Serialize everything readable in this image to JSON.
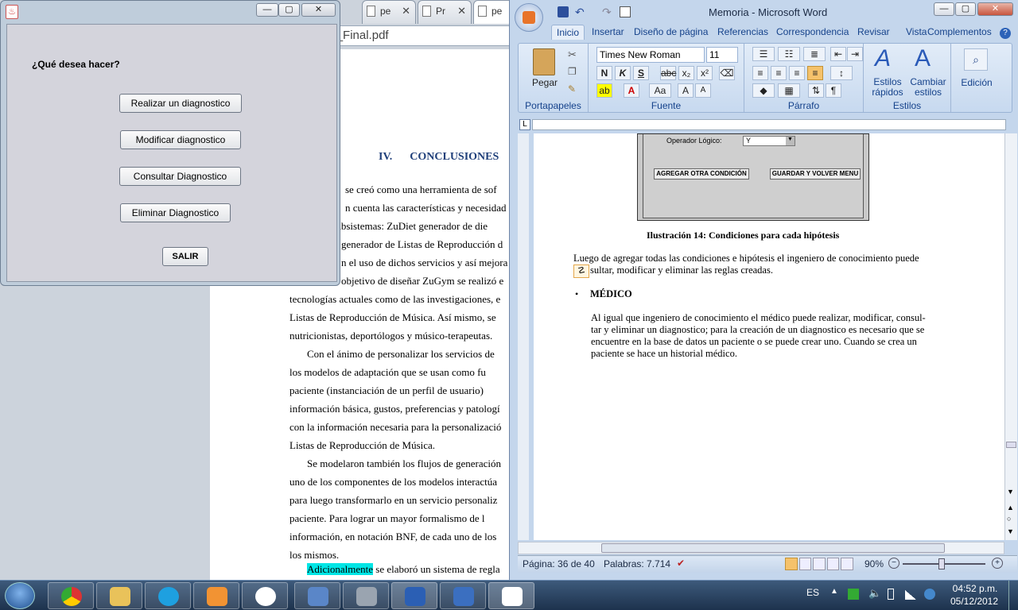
{
  "browser": {
    "tabs": [
      "pe",
      "pe",
      "Pr",
      "pe"
    ],
    "url": "ientos/MemoriaZuGym_Final.pdf",
    "pdf": {
      "heading_num": "IV.",
      "heading": "CONCLUSIONES",
      "lines": [
        "se creó como una herramienta de sof",
        "n cuenta las características y necesidad",
        "s subsistemas: ZuDiet generador de die",
        "generador de Listas de Reproducción d",
        "n el uso de dichos servicios y así mejora",
        "objetivo de diseñar ZuGym se realizó e",
        "tecnologías actuales como de las investigaciones, e",
        "Listas de Reproducción de Música. Así mismo, se",
        "nutricionistas, deportólogos y músico-terapeutas.",
        "Con el ánimo de personalizar los servicios de",
        "los modelos de adaptación que se usan como fu",
        "paciente (instanciación de un perfil de usuario)",
        "información básica, gustos, preferencias y patologí",
        "con la información necesaria para la personalizació",
        "Listas de Reproducción de Música.",
        "Se modelaron también los flujos de generación",
        "uno de los componentes de los modelos interactúa",
        "para luego transformarlo en un servicio personaliz",
        "paciente. Para lograr un mayor formalismo de l",
        "información, en notación BNF, de cada uno de los",
        "los mismos."
      ],
      "last_highlight": "Adicionalmente",
      "last_rest": " se elaboró un sistema de regla"
    }
  },
  "dialog": {
    "question": "¿Qué desea hacer?",
    "btn_create": "Realizar un diagnostico",
    "btn_modify": "Modificar diagnostico",
    "btn_consult": "Consultar Diagnostico",
    "btn_delete": "Eliminar Diagnostico",
    "btn_exit": "SALIR"
  },
  "word": {
    "title": "Memoria - Microsoft Word",
    "tabs": [
      "Inicio",
      "Insertar",
      "Diseño de página",
      "Referencias",
      "Correspondencia",
      "Revisar",
      "Vista",
      "Complementos"
    ],
    "font_name": "Times New Roman",
    "font_size": "11",
    "groups": {
      "clipboard": "Portapapeles",
      "font": "Fuente",
      "paragraph": "Párrafo",
      "styles": "Estilos"
    },
    "paste": "Pegar",
    "styles_quick": "Estilos rápidos",
    "styles_change": "Cambiar estilos",
    "editing": "Edición",
    "doc": {
      "operator_label": "Operador Lógico:",
      "operator_value": "Y",
      "add_condition": "AGREGAR OTRA CONDICIÓN",
      "save_return": "GUARDAR Y VOLVER MENU",
      "caption": "Ilustración 14: Condiciones para cada hipótesis",
      "para1a": "Luego de agregar todas las condiciones e hipótesis el ingeniero de conocimiento puede",
      "para1b": "sultar, modificar y eliminar las reglas creadas.",
      "bullet": "MÉDICO",
      "para2": [
        "Al igual que ingeniero de conocimiento el médico puede realizar, modificar, consul-",
        "tar y eliminar un diagnostico; para la creación de un diagnostico es necesario que se",
        "encuentre en la base de datos un paciente o se puede crear uno. Cuando se crea un",
        "paciente se hace un historial médico."
      ]
    },
    "status": {
      "page": "Página: 36 de 40",
      "words": "Palabras: 7.714",
      "zoom": "90%"
    }
  },
  "taskbar": {
    "lang": "ES",
    "time": "04:52 p.m.",
    "date": "05/12/2012"
  }
}
